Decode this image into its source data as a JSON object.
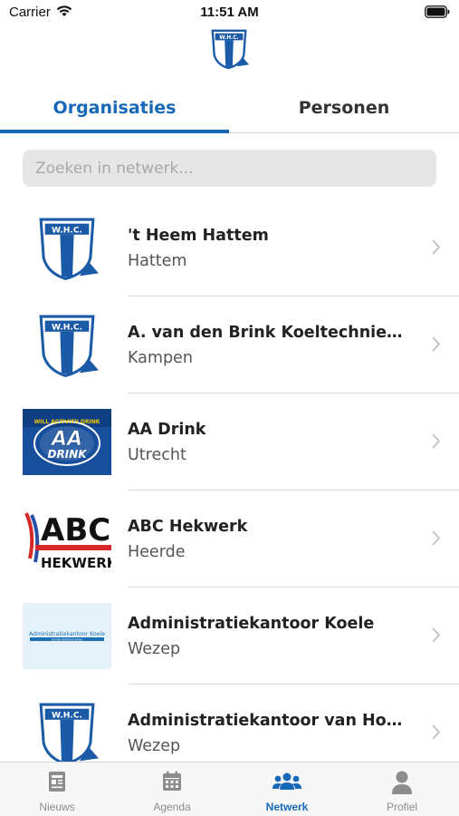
{
  "status_bar": {
    "carrier": "Carrier",
    "time": "11:51 AM"
  },
  "header": {
    "logo_icon": "whc-club-logo"
  },
  "tabs": [
    {
      "label": "Organisaties",
      "active": true
    },
    {
      "label": "Personen",
      "active": false
    }
  ],
  "search": {
    "placeholder": "Zoeken in netwerk..."
  },
  "organisations": [
    {
      "name": "'t Heem Hattem",
      "city": "Hattem",
      "logo": "whc-logo"
    },
    {
      "name": "A. van den Brink Koeltechniek...",
      "city": "Kampen",
      "logo": "whc-logo"
    },
    {
      "name": "AA Drink",
      "city": "Utrecht",
      "logo": "aa-drink-logo"
    },
    {
      "name": "ABC Hekwerk",
      "city": "Heerde",
      "logo": "abc-hekwerk-logo"
    },
    {
      "name": "Administratiekantoor Koele",
      "city": "Wezep",
      "logo": "administratiekantoor-koele-logo"
    },
    {
      "name": "Administratiekantoor van Ho...",
      "city": "Wezep",
      "logo": "whc-logo"
    }
  ],
  "logo_text": {
    "whc": "W.H.C.",
    "aa_drink_ring": "WILL ACTIVITY DRINK",
    "aa_drink_big": "AA",
    "aa_drink_word": "DRINK",
    "abc_top": "ABC",
    "abc_bottom": "HEKWERK",
    "koele_line1": "Administratiekantoor Koele",
    "koele_line2": "ADVIES-BOEKHOUDING"
  },
  "tabbar": [
    {
      "label": "Nieuws",
      "icon": "newspaper-icon",
      "active": false
    },
    {
      "label": "Agenda",
      "icon": "calendar-icon",
      "active": false
    },
    {
      "label": "Netwerk",
      "icon": "users-icon",
      "active": true
    },
    {
      "label": "Profiel",
      "icon": "user-icon",
      "active": false
    }
  ],
  "colors": {
    "accent": "#1769b8",
    "inactive": "#8c8c8c",
    "search_bg": "#e6e6e6"
  }
}
